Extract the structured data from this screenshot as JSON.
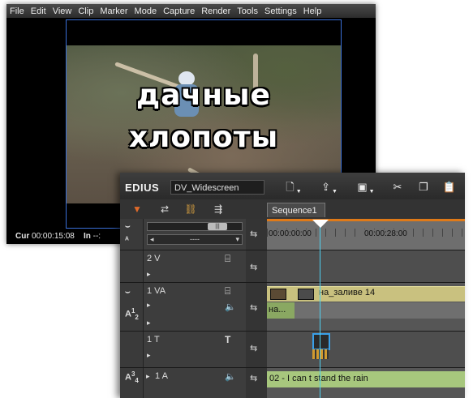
{
  "menu": [
    "File",
    "Edit",
    "View",
    "Clip",
    "Marker",
    "Mode",
    "Capture",
    "Render",
    "Tools",
    "Settings",
    "Help"
  ],
  "preview": {
    "caption_line1": "дачные",
    "caption_line2": "хлопоты",
    "cur_label": "Cur",
    "cur_value": "00:00:15:08",
    "in_label": "In",
    "in_value": "--:"
  },
  "timeline": {
    "app_name": "EDIUS",
    "project_name": "DV_Widescreen",
    "sequence_tab": "Sequence1",
    "zoom_select": "----",
    "ruler_labels": [
      "00:00:00:00",
      "00:00:28:00"
    ],
    "tracks": {
      "v2": {
        "name": "2 V"
      },
      "va1": {
        "name": "1 VA",
        "clip_label": "на_заливе 14",
        "audio_label": "на...",
        "side_a": "A",
        "side_n1": "1",
        "side_n2": "2"
      },
      "t1": {
        "name": "1 T"
      },
      "a1": {
        "name": "1 A",
        "clip_label": "02 - I can t stand the rain",
        "side_a": "A",
        "side_n1": "3",
        "side_n2": "4"
      }
    }
  },
  "colors": {
    "menubar": "#3a3a3a",
    "frame_border": "#3a6fd8",
    "ruler_orange": "#e07a18",
    "va_clip": "#c9c17f",
    "audio_clip": "#a7c77d",
    "playhead": "#4fd0f0"
  },
  "icons": [
    "new-file-icon",
    "open-icon",
    "save-icon",
    "cut-icon",
    "copy-icon",
    "paste-icon",
    "playhead-icon",
    "sync-icon",
    "speaker-icon",
    "title-t-icon",
    "lock-icon"
  ]
}
